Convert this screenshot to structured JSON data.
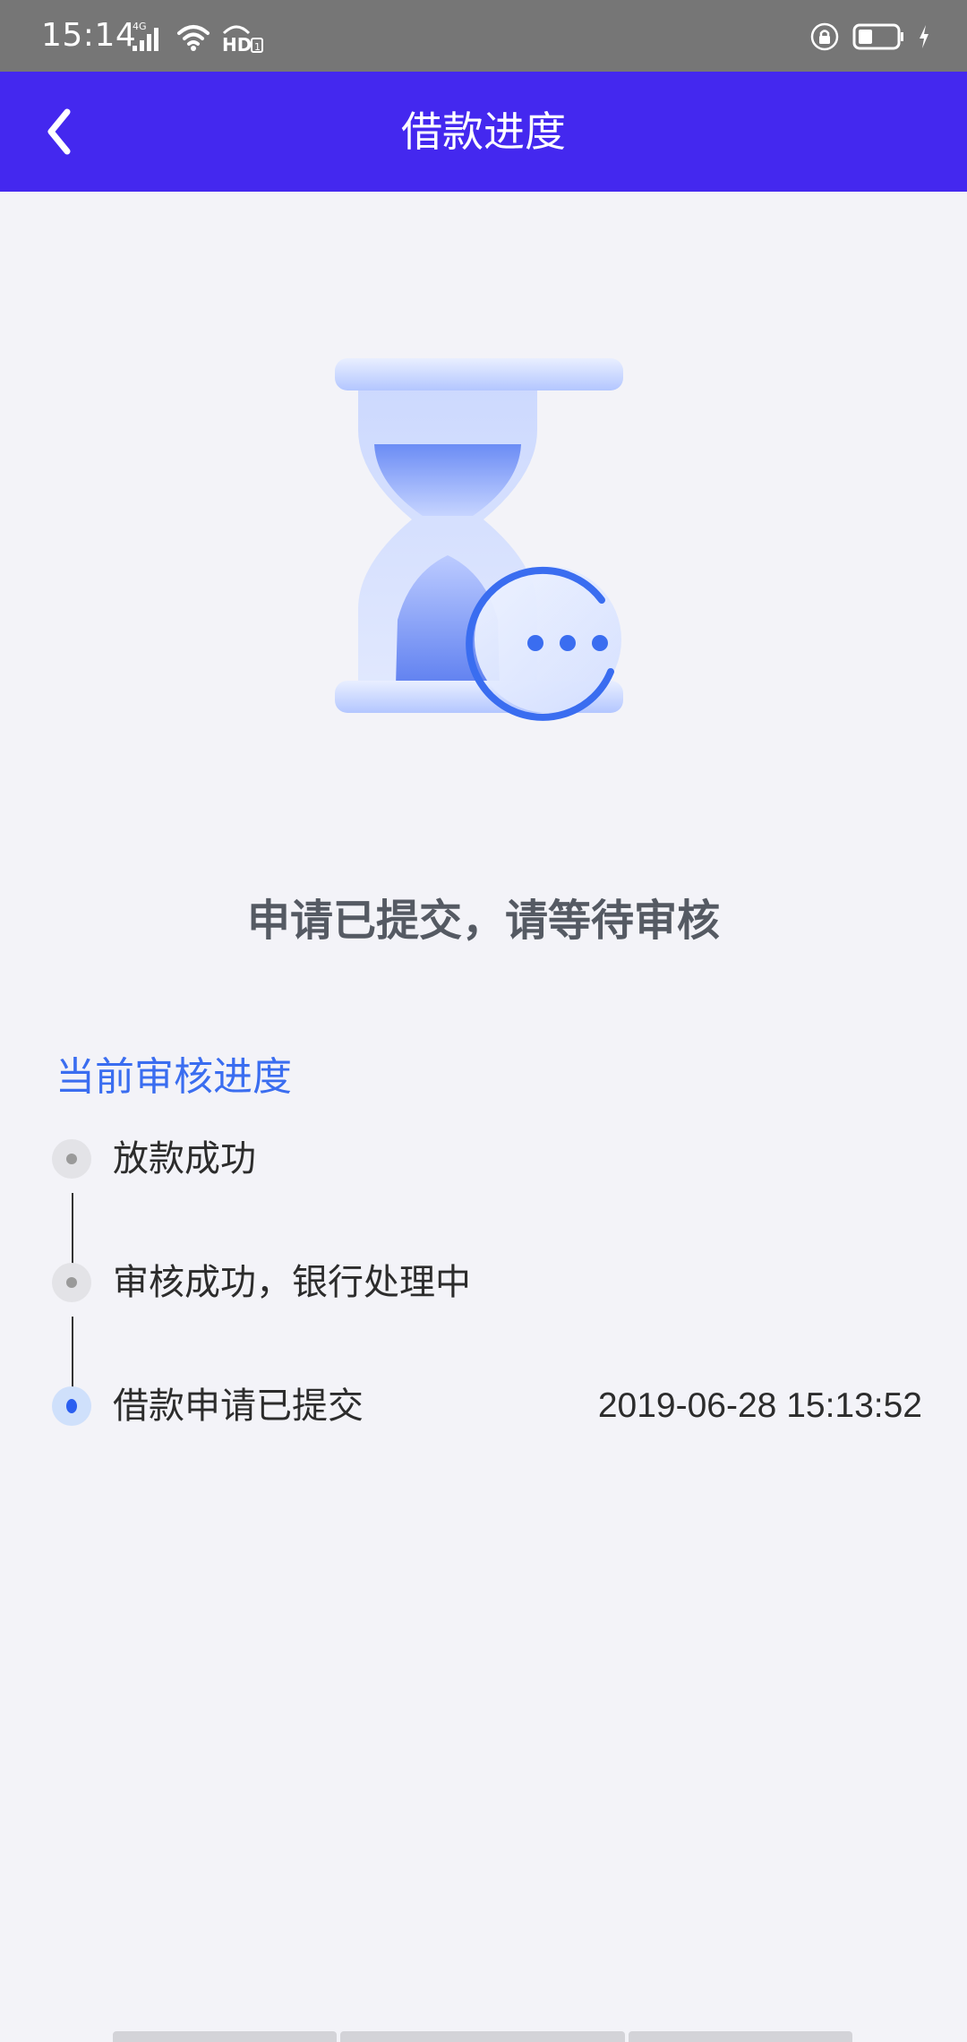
{
  "status_bar": {
    "time": "15:14",
    "network_label": "4G",
    "hd_label": "HD",
    "hd_sub": "1",
    "icons": [
      "signal-icon",
      "wifi-icon",
      "hd-call-icon",
      "rotation-lock-icon",
      "battery-icon",
      "charging-icon"
    ]
  },
  "app_bar": {
    "title": "借款进度",
    "back_icon": "chevron-left-icon",
    "background": "#4428ef"
  },
  "illustration": {
    "icon": "hourglass-pending-icon",
    "accent": "#3a6df0"
  },
  "message": "申请已提交，请等待审核",
  "progress": {
    "title": "当前审核进度",
    "steps": [
      {
        "label": "放款成功",
        "time": "",
        "active": false
      },
      {
        "label": "审核成功，银行处理中",
        "time": "",
        "active": false
      },
      {
        "label": "借款申请已提交",
        "time": "2019-06-28 15:13:52",
        "active": true
      }
    ]
  },
  "colors": {
    "background": "#f3f3f8",
    "active_dot": "#2b5ff0",
    "inactive_dot": "#9a9a9a",
    "progress_title": "#3a6df0"
  }
}
